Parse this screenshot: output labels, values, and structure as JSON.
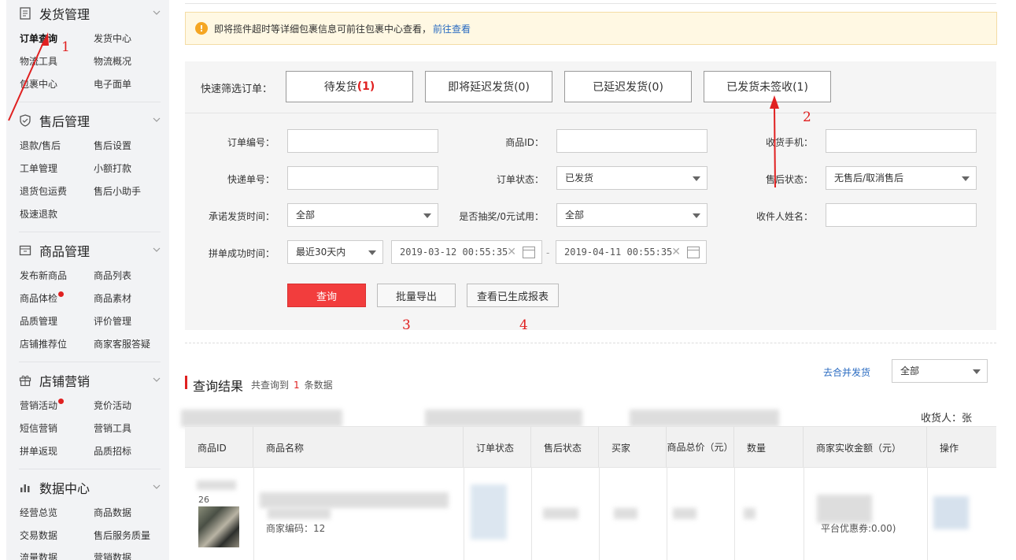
{
  "sidebar": {
    "sections": [
      {
        "title": "发货管理",
        "icon": "document-icon",
        "items": [
          "订单查询",
          "发货中心",
          "物流工具",
          "物流概况",
          "包裹中心",
          "电子面单"
        ]
      },
      {
        "title": "售后管理",
        "icon": "shield-icon",
        "items": [
          "退款/售后",
          "售后设置",
          "工单管理",
          "小额打款",
          "退货包运费",
          "售后小助手",
          "极速退款"
        ]
      },
      {
        "title": "商品管理",
        "icon": "box-icon",
        "items": [
          "发布新商品",
          "商品列表",
          "商品体检",
          "商品素材",
          "品质管理",
          "评价管理",
          "店铺推荐位",
          "商家客服答疑"
        ]
      },
      {
        "title": "店铺营销",
        "icon": "gift-icon",
        "items": [
          "营销活动",
          "竞价活动",
          "短信营销",
          "营销工具",
          "拼单返现",
          "品质招标"
        ]
      },
      {
        "title": "数据中心",
        "icon": "bar-chart-icon",
        "items": [
          "经营总览",
          "商品数据",
          "交易数据",
          "售后服务质量",
          "流量数据",
          "营销数据"
        ]
      }
    ]
  },
  "notice": {
    "text": "即将揽件超时等详细包裹信息可前往包裹中心查看，",
    "link": "前往查看"
  },
  "quick_filter": {
    "label": "快速筛选订单：",
    "buttons": [
      {
        "text": "待发货",
        "count": "(1)"
      },
      {
        "text": "即将延迟发货(0)"
      },
      {
        "text": "已延迟发货(0)"
      },
      {
        "text": "已发货未签收(1)"
      }
    ]
  },
  "form": {
    "order_no": {
      "label": "订单编号：",
      "value": ""
    },
    "product_id": {
      "label": "商品ID：",
      "value": ""
    },
    "phone": {
      "label": "收货手机：",
      "value": ""
    },
    "express_no": {
      "label": "快递单号：",
      "value": ""
    },
    "order_status": {
      "label": "订单状态：",
      "value": "已发货"
    },
    "after_sale_status": {
      "label": "售后状态：",
      "value": "无售后/取消售后"
    },
    "promise_time": {
      "label": "承诺发货时间：",
      "value": "全部"
    },
    "lottery": {
      "label": "是否抽奖/0元试用：",
      "value": "全部"
    },
    "receiver_name": {
      "label": "收件人姓名：",
      "value": ""
    },
    "group_time": {
      "label": "拼单成功时间：",
      "value": "最近30天内"
    },
    "date_start": "2019-03-12 00:55:35",
    "date_end": "2019-04-11 00:55:35",
    "date_sep": "-"
  },
  "actions": {
    "query": "查询",
    "export": "批量导出",
    "reports": "查看已生成报表"
  },
  "annotations": {
    "a1": "1",
    "a2": "2",
    "a3": "3",
    "a4": "4"
  },
  "results": {
    "title": "查询结果",
    "count_prefix": "共查询到",
    "count": "1",
    "count_suffix": "条数据",
    "merge_link": "去合并发货",
    "filter_value": "全部",
    "receiver_label": "收货人：张",
    "columns": [
      "商品ID",
      "商品名称",
      "订单状态",
      "售后状态",
      "买家",
      "商品总价（元）",
      "数量",
      "商家实收金额（元）",
      "操作"
    ],
    "row": {
      "pid_suffix": "26",
      "merchant_code": "商家编码：12",
      "coupon": "平台优惠券:0.00)"
    }
  },
  "colors": {
    "accent_red": "#e02020",
    "link_blue": "#2a6bc1",
    "query_red": "#f23d3d"
  }
}
